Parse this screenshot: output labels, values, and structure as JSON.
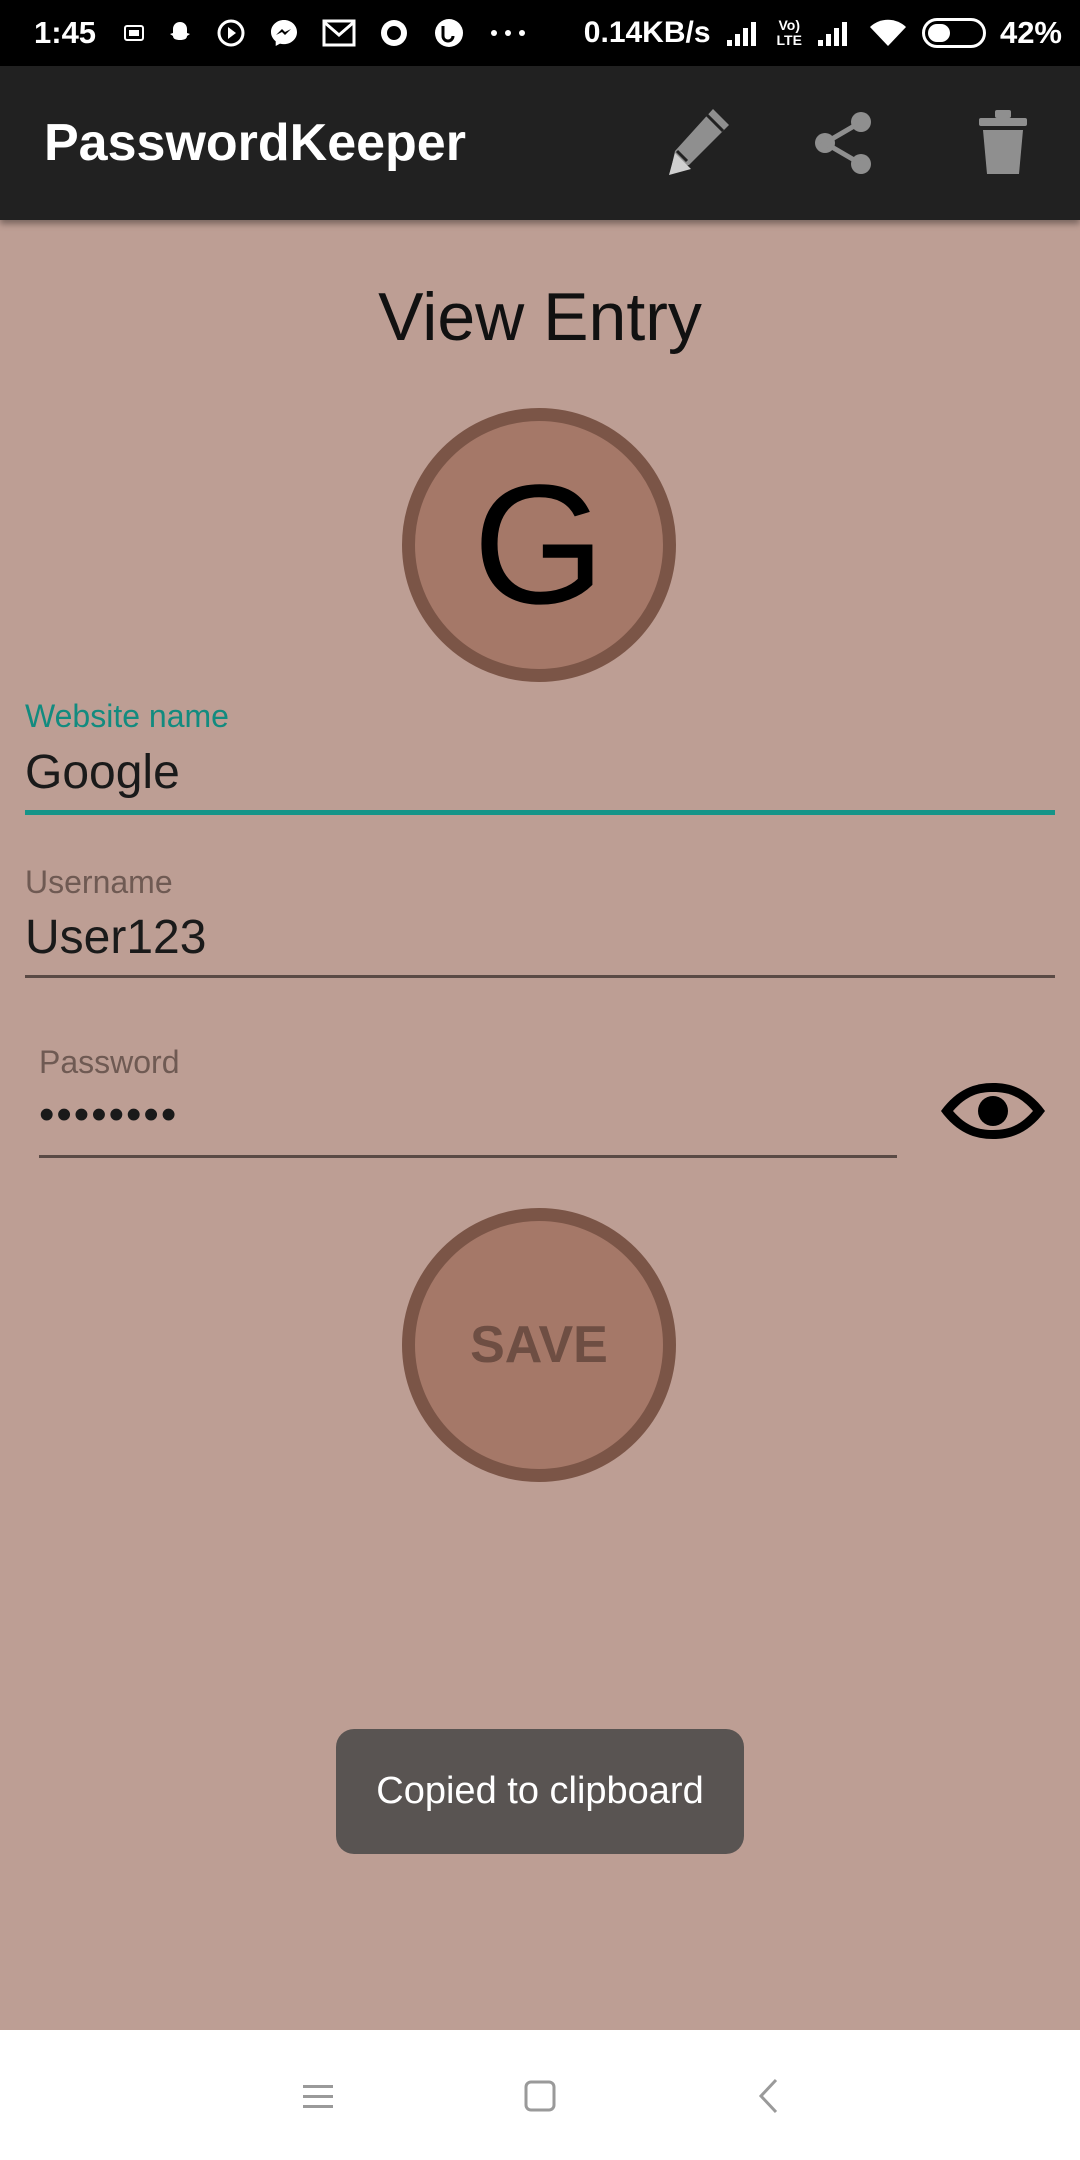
{
  "status_bar": {
    "time": "1:45",
    "network_speed": "0.14KB/s",
    "volte_label_top": "Vo)",
    "volte_label_bottom": "LTE",
    "battery_percent": "42%",
    "battery_level": 0.42,
    "notification_icons": [
      "sim-card-icon",
      "snapchat-icon",
      "play-icon",
      "messenger-icon",
      "gmail-icon",
      "record-icon",
      "uc-browser-icon",
      "more-dots-icon"
    ]
  },
  "app_bar": {
    "title": "PasswordKeeper",
    "actions": [
      "edit-pencil-icon",
      "share-icon",
      "trash-icon"
    ]
  },
  "page": {
    "heading": "View Entry",
    "avatar_letter": "G"
  },
  "form": {
    "website": {
      "label": "Website name",
      "value": "Google"
    },
    "username": {
      "label": "Username",
      "value": "User123"
    },
    "password": {
      "label": "Password",
      "value": "••••••••"
    },
    "save_label": "SAVE"
  },
  "toast": {
    "message": "Copied to clipboard"
  },
  "nav_bar": {
    "buttons": [
      "menu-icon",
      "home-icon",
      "back-icon"
    ]
  },
  "colors": {
    "background": "#bd9e94",
    "app_bar": "#212121",
    "accent": "#159488",
    "circle_fill": "#a57868",
    "circle_border": "#7b5547"
  }
}
